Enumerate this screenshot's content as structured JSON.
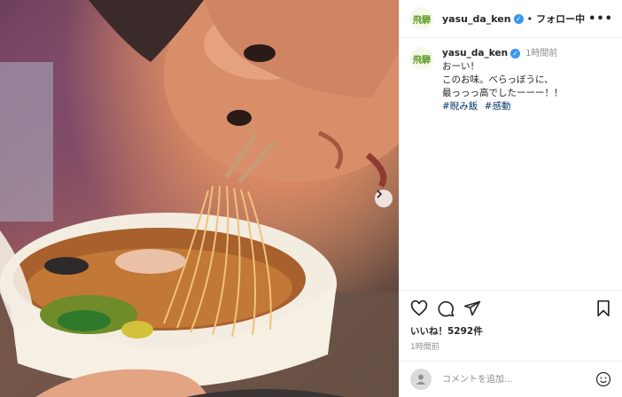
{
  "header": {
    "avatar_text": "飛騨",
    "username": "yasu_da_ken",
    "separator": "•",
    "follow_label": "フォロー中",
    "more_label": "•••"
  },
  "caption": {
    "avatar_text": "飛騨",
    "username": "yasu_da_ken",
    "time": "1時間前",
    "lines": [
      "おーい！",
      "このお味。べらっぼうに、",
      "最っっっ高でしたーーー！！"
    ],
    "tags": [
      "#睨み飯",
      "#感動"
    ]
  },
  "actions": {
    "likes": "いいね！5292件",
    "time": "1時間前"
  },
  "comment": {
    "placeholder": "コメントを追加..."
  },
  "colors": {
    "verified": "#3897f0",
    "hashtag": "#00376b",
    "avatar_green": "#5f9b2c"
  },
  "icons": [
    "chevron-right-icon",
    "heart-icon",
    "comment-icon",
    "share-icon",
    "bookmark-icon",
    "user-icon",
    "emoji-icon",
    "verified-icon"
  ]
}
